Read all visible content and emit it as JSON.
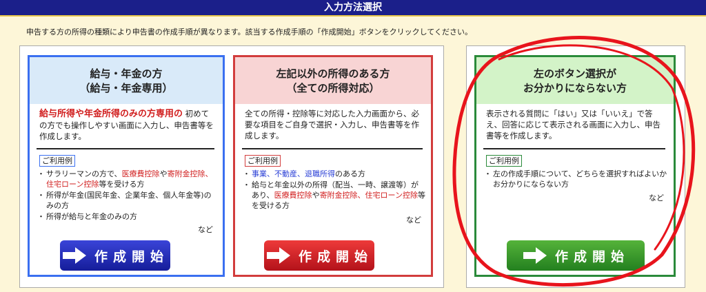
{
  "header": {
    "title": "入力方法選択"
  },
  "intro": "申告する方の所得の種類により申告書の作成手順が異なります。該当する作成手順の「作成開始」ボタンをクリックしてください。",
  "cards": [
    {
      "title_line1": "給与・年金の方",
      "title_line2": "（給与・年金専用）",
      "desc_highlight": "給与所得や年金所得のみの方専用の",
      "desc_text": "初めての方でも操作しやすい画面に入力し、申告書等を作成します。",
      "example_label": "ご利用例",
      "examples": [
        {
          "a": "サラリーマンの方で、",
          "b": "医療費控除",
          "c": "や",
          "d": "寄附金控除、住宅ローン控除",
          "e": "等を受ける方"
        },
        {
          "a": "所得が年金(国民年金、企業年金、個人年金等)のみの方"
        },
        {
          "a": "所得が給与と年金のみの方"
        }
      ],
      "nado": "など",
      "button": "作成開始"
    },
    {
      "title_line1": "左記以外の所得のある方",
      "title_line2": "（全ての所得対応）",
      "desc_text": "全ての所得・控除等に対応した入力画面から、必要な項目をご自身で選択・入力し、申告書等を作成します。",
      "example_label": "ご利用例",
      "examples": [
        {
          "a": "事業、不動産、退職所得",
          "b": "のある方"
        },
        {
          "a": "給与と年金以外の所得（配当、一時、譲渡等）があり、",
          "b": "医療費控除",
          "c": "や",
          "d": "寄附金控除、住宅ローン控除",
          "e": "等を受ける方"
        }
      ],
      "nado": "など",
      "button": "作成開始"
    },
    {
      "title_line1": "左のボタン選択が",
      "title_line2": "お分かりにならない方",
      "desc_text": "表示される質問に「はい」又は「いいえ」で答え、回答に応じて表示される画面に入力し、申告書等を作成します。",
      "example_label": "ご利用例",
      "examples": [
        {
          "a": "左の作成手順について、どちらを選択すればよいかお分かりにならない方"
        }
      ],
      "nado": "など",
      "button": "作成開始"
    }
  ],
  "colors": {
    "header": "#1b1f8a",
    "blue": "#3a6ff0",
    "red": "#d23c3c",
    "green": "#2a8a3a",
    "annotation": "#e8141c"
  }
}
